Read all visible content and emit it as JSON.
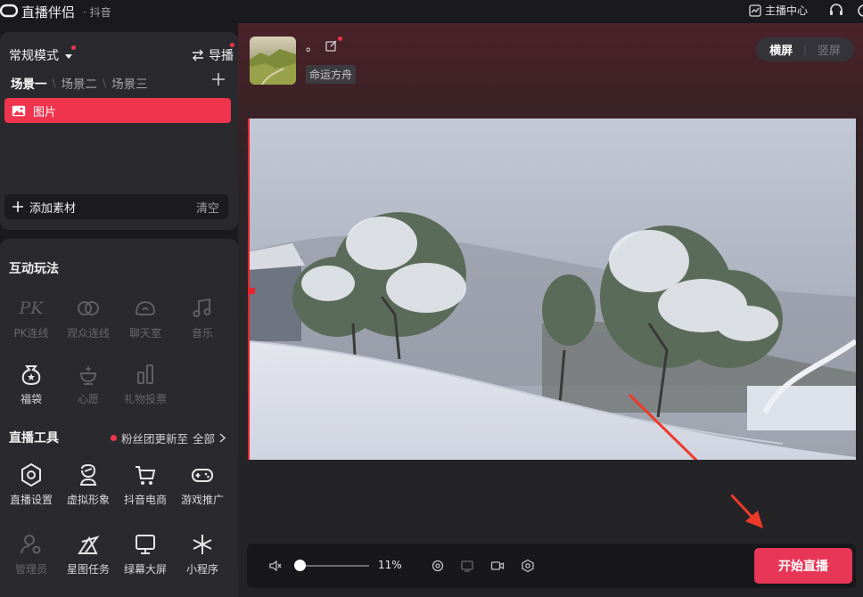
{
  "titlebar": {
    "app_name": "直播伴侣",
    "app_sub": "· 抖音",
    "anchor_center": "主播中心"
  },
  "scene_panel": {
    "mode": "常规模式",
    "director": "导播",
    "tabs": [
      "场景一",
      "场景二",
      "场景三"
    ],
    "source_item": "图片",
    "add_material": "添加素材",
    "clear": "清空"
  },
  "interact": {
    "title": "互动玩法",
    "items": [
      {
        "label": "PK连线",
        "icon": "pk-icon",
        "enabled": false
      },
      {
        "label": "观众连线",
        "icon": "audience-link-icon",
        "enabled": false
      },
      {
        "label": "聊天室",
        "icon": "chatroom-icon",
        "enabled": false
      },
      {
        "label": "音乐",
        "icon": "music-icon",
        "enabled": false
      },
      {
        "label": "福袋",
        "icon": "lucky-bag-icon",
        "enabled": true
      },
      {
        "label": "心愿",
        "icon": "wish-icon",
        "enabled": false
      },
      {
        "label": "礼物投票",
        "icon": "gift-vote-icon",
        "enabled": false
      }
    ]
  },
  "tools": {
    "title": "直播工具",
    "fans_update": "粉丝团更新至",
    "all": "全部",
    "items": [
      {
        "label": "直播设置",
        "icon": "live-settings-icon",
        "enabled": true
      },
      {
        "label": "虚拟形象",
        "icon": "virtual-avatar-icon",
        "enabled": true
      },
      {
        "label": "抖音电商",
        "icon": "shop-cart-icon",
        "enabled": true
      },
      {
        "label": "游戏推广",
        "icon": "gamepad-icon",
        "enabled": true
      },
      {
        "label": "管理员",
        "icon": "admin-icon",
        "enabled": false
      },
      {
        "label": "星图任务",
        "icon": "star-task-icon",
        "enabled": true
      },
      {
        "label": "绿幕大屏",
        "icon": "green-screen-icon",
        "enabled": true
      },
      {
        "label": "小程序",
        "icon": "mini-program-icon",
        "enabled": true
      }
    ]
  },
  "preview": {
    "nickname": "。",
    "tag": "命运方舟",
    "orientation_landscape": "横屏",
    "orientation_portrait": "竖屏"
  },
  "bottom_bar": {
    "volume": "11%",
    "start_button": "开始直播"
  },
  "colors": {
    "accent": "#e83657",
    "selected_source": "#f0344e"
  }
}
